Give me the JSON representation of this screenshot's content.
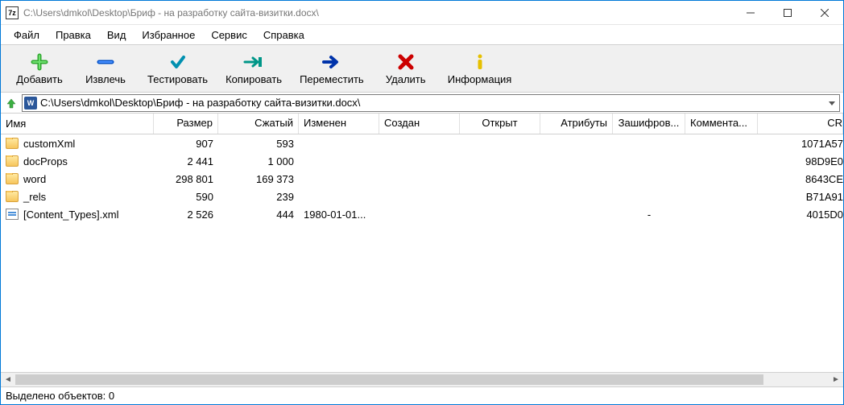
{
  "titlebar": {
    "icon_text": "7z",
    "title": "C:\\Users\\dmkol\\Desktop\\Бриф - на разработку сайта-визитки.docx\\"
  },
  "menus": [
    "Файл",
    "Правка",
    "Вид",
    "Избранное",
    "Сервис",
    "Справка"
  ],
  "toolbar": [
    {
      "name": "add",
      "label": "Добавить"
    },
    {
      "name": "extract",
      "label": "Извлечь"
    },
    {
      "name": "test",
      "label": "Тестировать"
    },
    {
      "name": "copy",
      "label": "Копировать"
    },
    {
      "name": "move",
      "label": "Переместить"
    },
    {
      "name": "delete",
      "label": "Удалить"
    },
    {
      "name": "info",
      "label": "Информация"
    }
  ],
  "path": "C:\\Users\\dmkol\\Desktop\\Бриф - на разработку сайта-визитки.docx\\",
  "columns": [
    "Имя",
    "Размер",
    "Сжатый",
    "Изменен",
    "Создан",
    "Открыт",
    "Атрибуты",
    "Зашифров...",
    "Коммента...",
    "CR"
  ],
  "rows": [
    {
      "icon": "folder",
      "name": "customXml",
      "size": "907",
      "packed": "593",
      "modified": "",
      "encrypted": "",
      "crc": "1071A57"
    },
    {
      "icon": "folder",
      "name": "docProps",
      "size": "2 441",
      "packed": "1 000",
      "modified": "",
      "encrypted": "",
      "crc": "98D9E0"
    },
    {
      "icon": "folder",
      "name": "word",
      "size": "298 801",
      "packed": "169 373",
      "modified": "",
      "encrypted": "",
      "crc": "8643CE"
    },
    {
      "icon": "folder",
      "name": "_rels",
      "size": "590",
      "packed": "239",
      "modified": "",
      "encrypted": "",
      "crc": "B71A91"
    },
    {
      "icon": "xml",
      "name": "[Content_Types].xml",
      "size": "2 526",
      "packed": "444",
      "modified": "1980-01-01...",
      "encrypted": "-",
      "crc": "4015D0"
    }
  ],
  "statusbar": "Выделено объектов: 0"
}
